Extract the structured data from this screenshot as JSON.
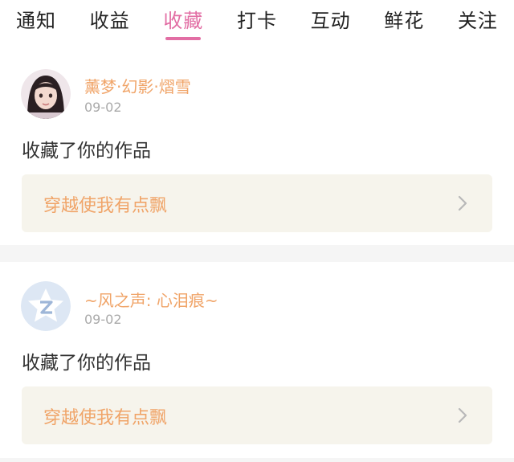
{
  "tabs": [
    {
      "label": "通知",
      "active": false
    },
    {
      "label": "收益",
      "active": false
    },
    {
      "label": "收藏",
      "active": true
    },
    {
      "label": "打卡",
      "active": false
    },
    {
      "label": "互动",
      "active": false
    },
    {
      "label": "鲜花",
      "active": false
    },
    {
      "label": "关注",
      "active": false
    }
  ],
  "notifications": [
    {
      "username": "薰梦·幻影·熠雪",
      "date": "09-02",
      "action": "收藏了你的作品",
      "work_title": "穿越使我有点飘",
      "avatar_icon": "user-photo-avatar"
    },
    {
      "username": "~风之声: 心泪痕~",
      "date": "09-02",
      "action": "收藏了你的作品",
      "work_title": "穿越使我有点飘",
      "avatar_icon": "default-star-avatar"
    }
  ],
  "colors": {
    "accent": "#e26ea4",
    "username": "#f0a468",
    "work_box_bg": "#f6f4ec"
  }
}
